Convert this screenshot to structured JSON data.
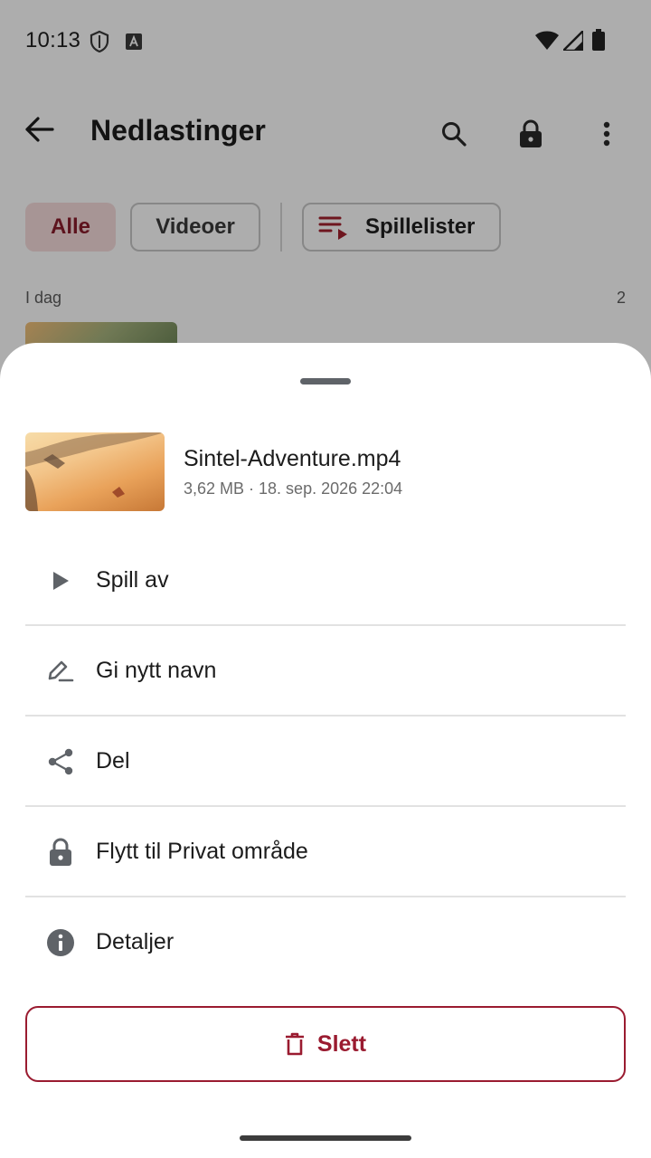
{
  "status_bar": {
    "time": "10:13"
  },
  "app_bar": {
    "title": "Nedlastinger"
  },
  "filters": {
    "all": "Alle",
    "videos": "Videoer",
    "playlists": "Spillelister"
  },
  "section": {
    "label": "I dag",
    "count": "2"
  },
  "sheet": {
    "file": {
      "name": "Sintel-Adventure.mp4",
      "meta": "3,62 MB · 18. sep. 2026 22:04"
    },
    "actions": {
      "play": "Spill av",
      "rename": "Gi nytt navn",
      "share": "Del",
      "move_private": "Flytt til Privat område",
      "details": "Detaljer"
    },
    "delete_label": "Slett"
  },
  "colors": {
    "accent": "#9a1b30",
    "chip_selected_bg": "#f7dcdc",
    "scrim": "rgba(0,0,0,0.32)"
  },
  "icons": {
    "status": [
      "shield-icon",
      "font-a-icon",
      "wifi-icon",
      "signal-icon",
      "battery-icon"
    ],
    "app_bar": [
      "back-arrow-icon",
      "search-icon",
      "lock-icon",
      "more-vert-icon"
    ],
    "menu": [
      "play-icon",
      "rename-pen-icon",
      "share-icon",
      "lock-icon",
      "info-icon"
    ],
    "delete": "trash-icon"
  }
}
